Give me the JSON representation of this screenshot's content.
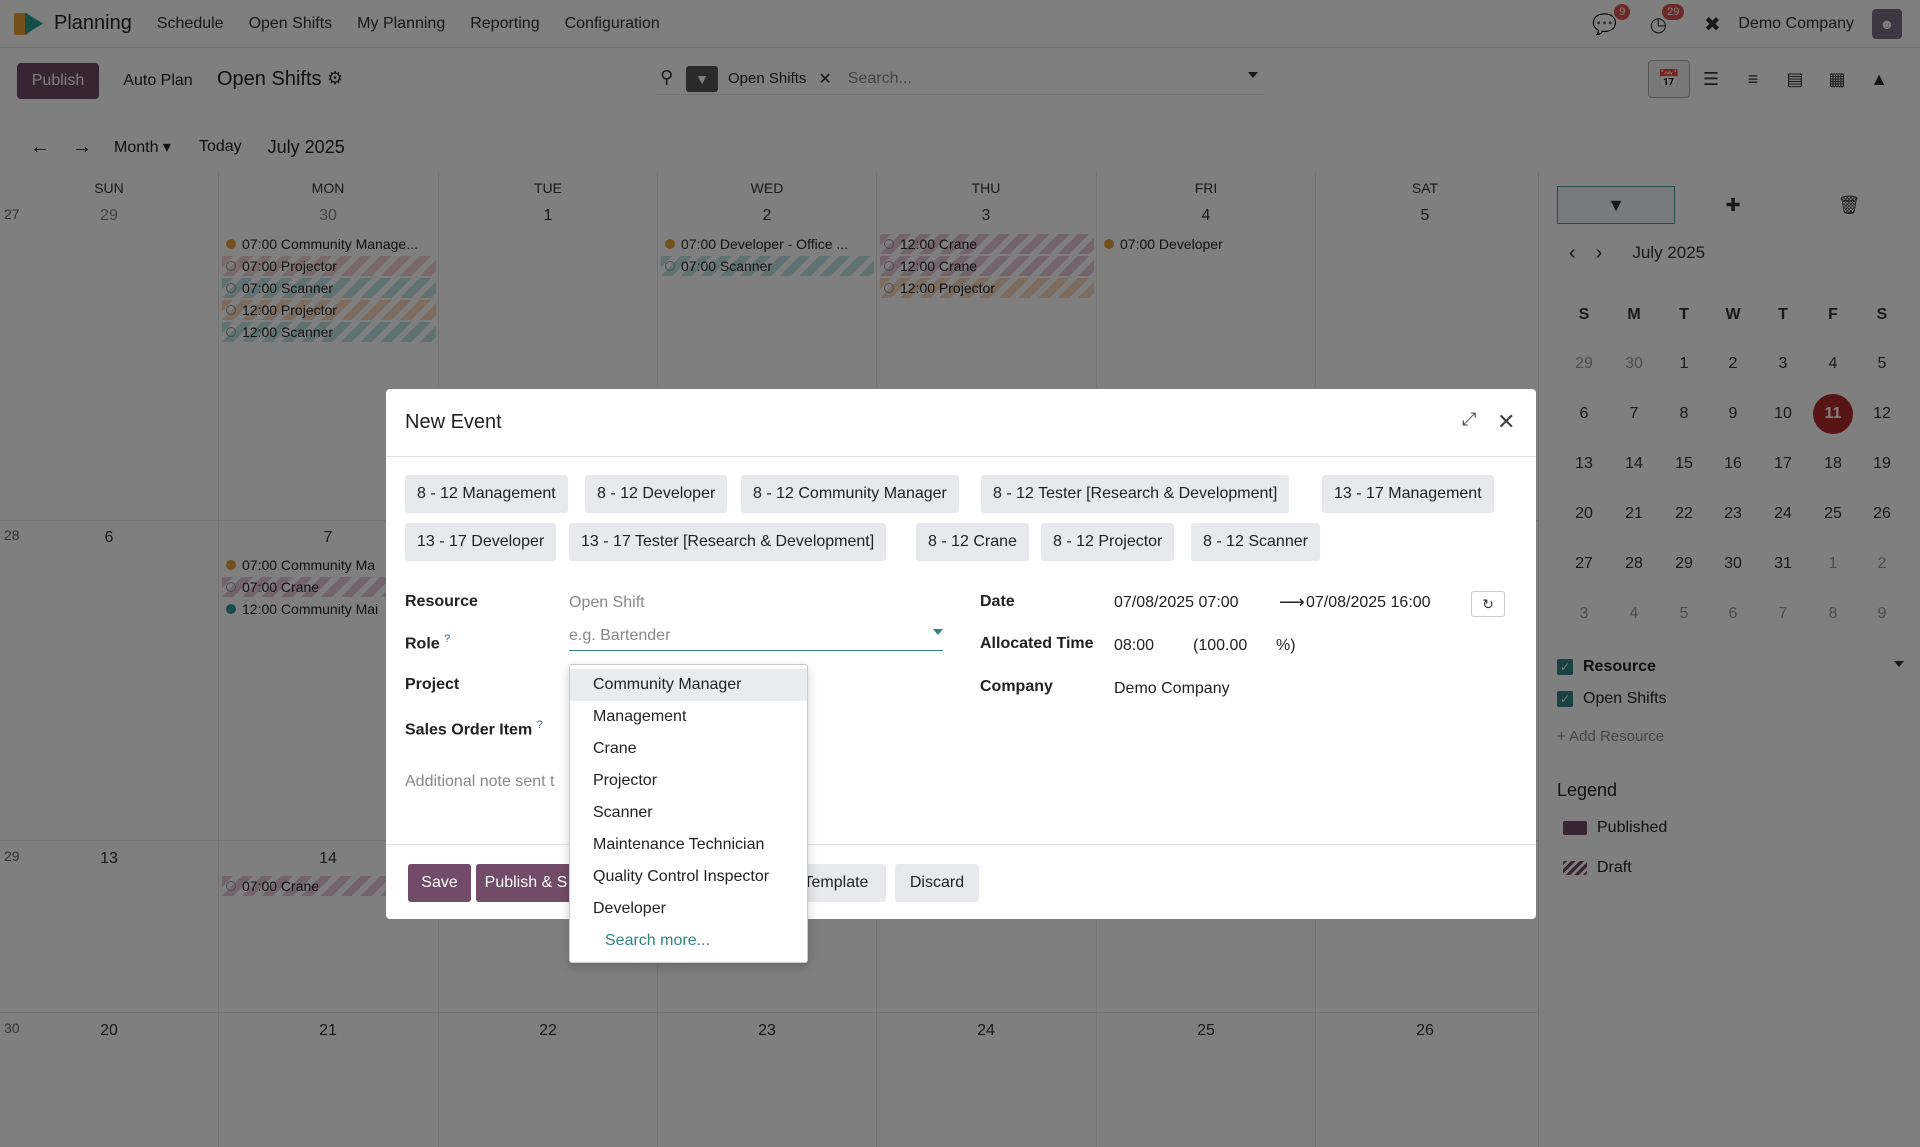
{
  "topnav": {
    "app_name": "Planning",
    "menu": [
      "Schedule",
      "Open Shifts",
      "My Planning",
      "Reporting",
      "Configuration"
    ],
    "messages_badge": "9",
    "activities_badge": "29",
    "company": "Demo Company"
  },
  "controlpanel": {
    "publish_label": "Publish",
    "autoplan_label": "Auto Plan",
    "title": "Open Shifts",
    "facet_label": "Open Shifts",
    "search_placeholder": "Search..."
  },
  "caltoolbar": {
    "scale": "Month",
    "today": "Today",
    "period": "July 2025"
  },
  "calendar": {
    "dayheads": [
      "SUN",
      "MON",
      "TUE",
      "WED",
      "THU",
      "FRI",
      "SAT"
    ],
    "weeks": [
      {
        "num": "27",
        "days": [
          "29",
          "30",
          "1",
          "2",
          "3",
          "4",
          "5"
        ]
      },
      {
        "num": "28",
        "days": [
          "6",
          "7",
          "",
          "",
          "",
          "",
          ""
        ]
      },
      {
        "num": "29",
        "days": [
          "13",
          "14",
          "",
          "",
          "",
          "",
          ""
        ]
      },
      {
        "num": "30",
        "days": [
          "20",
          "21",
          "22",
          "23",
          "24",
          "25",
          "26"
        ]
      }
    ],
    "events": {
      "mon1": [
        "07:00 Community Manage...",
        "07:00 Projector",
        "07:00 Scanner",
        "12:00 Projector",
        "12:00 Scanner"
      ],
      "wed1": [
        "07:00 Developer - Office ...",
        "07:00 Scanner"
      ],
      "thu1": [
        "12:00 Crane",
        "12:00 Crane",
        "12:00 Projector"
      ],
      "fri1": [
        "07:00 Developer"
      ],
      "mon2": [
        "07:00 Community Ma",
        "07:00 Crane",
        "12:00 Community Mai"
      ],
      "mon3": [
        "07:00 Crane"
      ]
    }
  },
  "sidebar": {
    "mini_title": "July 2025",
    "mini_heads": [
      "S",
      "M",
      "T",
      "W",
      "T",
      "F",
      "S"
    ],
    "mini_weeks": [
      [
        "29",
        "30",
        "1",
        "2",
        "3",
        "4",
        "5"
      ],
      [
        "6",
        "7",
        "8",
        "9",
        "10",
        "11",
        "12"
      ],
      [
        "13",
        "14",
        "15",
        "16",
        "17",
        "18",
        "19"
      ],
      [
        "20",
        "21",
        "22",
        "23",
        "24",
        "25",
        "26"
      ],
      [
        "27",
        "28",
        "29",
        "30",
        "31",
        "1",
        "2"
      ],
      [
        "3",
        "4",
        "5",
        "6",
        "7",
        "8",
        "9"
      ]
    ],
    "resource_label": "Resource",
    "open_shifts_label": "Open Shifts",
    "add_resource": "+ Add Resource",
    "legend_title": "Legend",
    "legend_published": "Published",
    "legend_draft": "Draft"
  },
  "modal": {
    "title": "New Event",
    "templates": [
      "8 - 12 Management",
      "8 - 12 Developer",
      "8 - 12 Community Manager",
      "8 - 12 Tester [Research & Development]",
      "13 - 17 Management",
      "13 - 17 Developer",
      "13 - 17 Tester [Research & Development]",
      "8 - 12 Crane",
      "8 - 12 Projector",
      "8 - 12 Scanner"
    ],
    "resource_label": "Resource",
    "resource_value": "Open Shift",
    "role_label": "Role",
    "role_placeholder": "e.g. Bartender",
    "project_label": "Project",
    "sale_label": "Sales Order Item",
    "note_placeholder": "Additional note sent t",
    "date_label": "Date",
    "date_start": "07/08/2025 07:00",
    "date_end": "07/08/2025 16:00",
    "alloc_label": "Allocated Time",
    "alloc_hours": "08:00",
    "alloc_pct": "(100.00",
    "alloc_pct_sign": "%)",
    "company_label": "Company",
    "company_value": "Demo Company",
    "save": "Save",
    "publish_save": "Publish & S",
    "save_template": "Template",
    "discard": "Discard"
  },
  "dropdown": {
    "items": [
      "Community Manager",
      "Management",
      "Crane",
      "Projector",
      "Scanner",
      "Maintenance Technician",
      "Quality Control Inspector",
      "Developer"
    ],
    "search_more": "Search more..."
  }
}
